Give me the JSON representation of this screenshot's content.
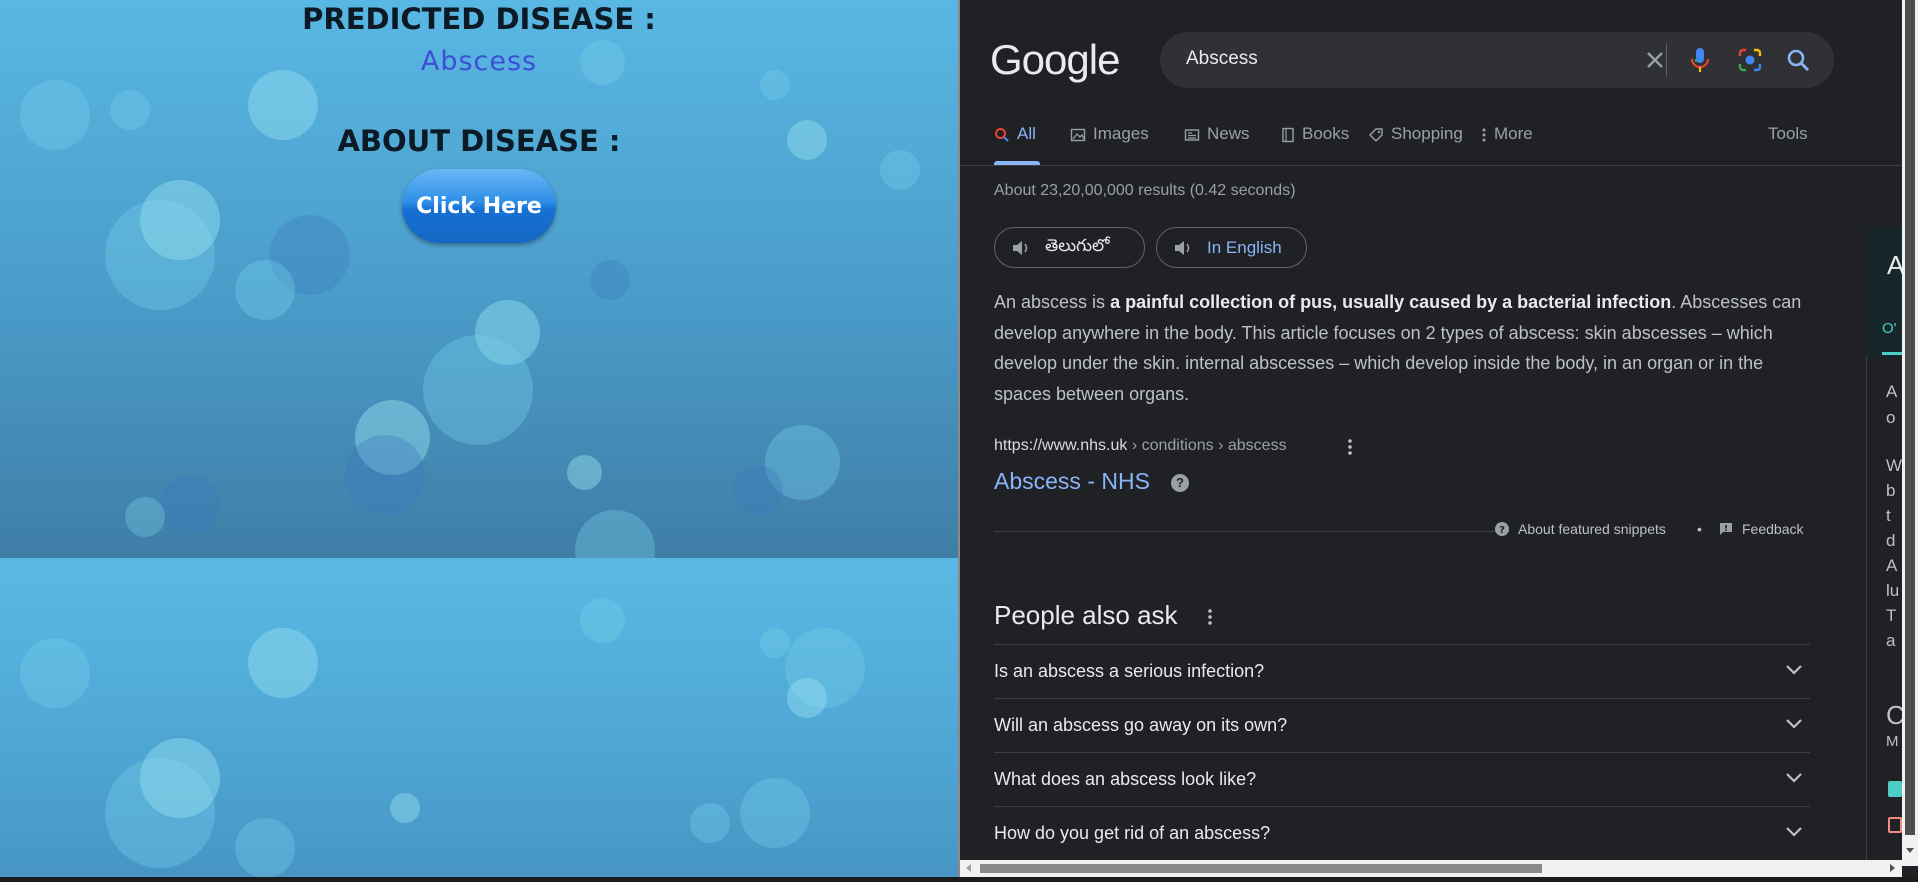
{
  "left_app": {
    "predicted_heading": "PREDICTED DISEASE :",
    "predicted_value": "Abscess",
    "about_heading": "ABOUT DISEASE :",
    "button_label": "Click Here"
  },
  "google": {
    "logo": "Google",
    "search": {
      "value": "Abscess"
    },
    "icons": [
      "clear-icon",
      "microphone-icon",
      "camera-lens-icon",
      "search-icon"
    ],
    "tabs": [
      {
        "label": "All",
        "icon": "search-icon",
        "active": true
      },
      {
        "label": "Images",
        "icon": "image-icon"
      },
      {
        "label": "News",
        "icon": "news-icon"
      },
      {
        "label": "Books",
        "icon": "book-icon"
      },
      {
        "label": "Shopping",
        "icon": "tag-icon"
      },
      {
        "label": "More",
        "icon": "more-vert-icon"
      },
      {
        "label": "Tools"
      }
    ],
    "result_count": "About 23,20,00,000 results (0.42 seconds)",
    "lang_chips": [
      {
        "label": "తెలుగులో"
      },
      {
        "label": "In English"
      }
    ],
    "snippet": {
      "prefix": "An abscess is ",
      "bold": "a painful collection of pus, usually caused by a bacterial infection",
      "suffix": ". Abscesses can develop anywhere in the body. This article focuses on 2 types of abscess: skin abscesses – which develop under the skin. internal abscesses – which develop inside the body, in an organ or in the spaces between organs."
    },
    "citation": {
      "domain": "https://www.nhs.uk",
      "path": " › conditions › abscess"
    },
    "result_title": "Abscess - NHS",
    "help_badge": "?",
    "about_snippets": "About featured snippets",
    "separator": "•",
    "feedback": "Feedback",
    "paa": {
      "title": "People also ask",
      "questions": [
        "Is an abscess a serious infection?",
        "Will an abscess go away on its own?",
        "What does an abscess look like?",
        "How do you get rid of an abscess?"
      ]
    },
    "knowledge_panel": {
      "title_fragment": "A",
      "tab_fragment": "O'",
      "text_fragments": [
        "A",
        "o",
        "W",
        "b",
        "t",
        "d",
        "A",
        "lu",
        "T",
        "a",
        "C",
        "M"
      ]
    },
    "colors": {
      "accent": "#8ab4f8",
      "background": "#202124",
      "teal": "#4ecdc4"
    }
  }
}
